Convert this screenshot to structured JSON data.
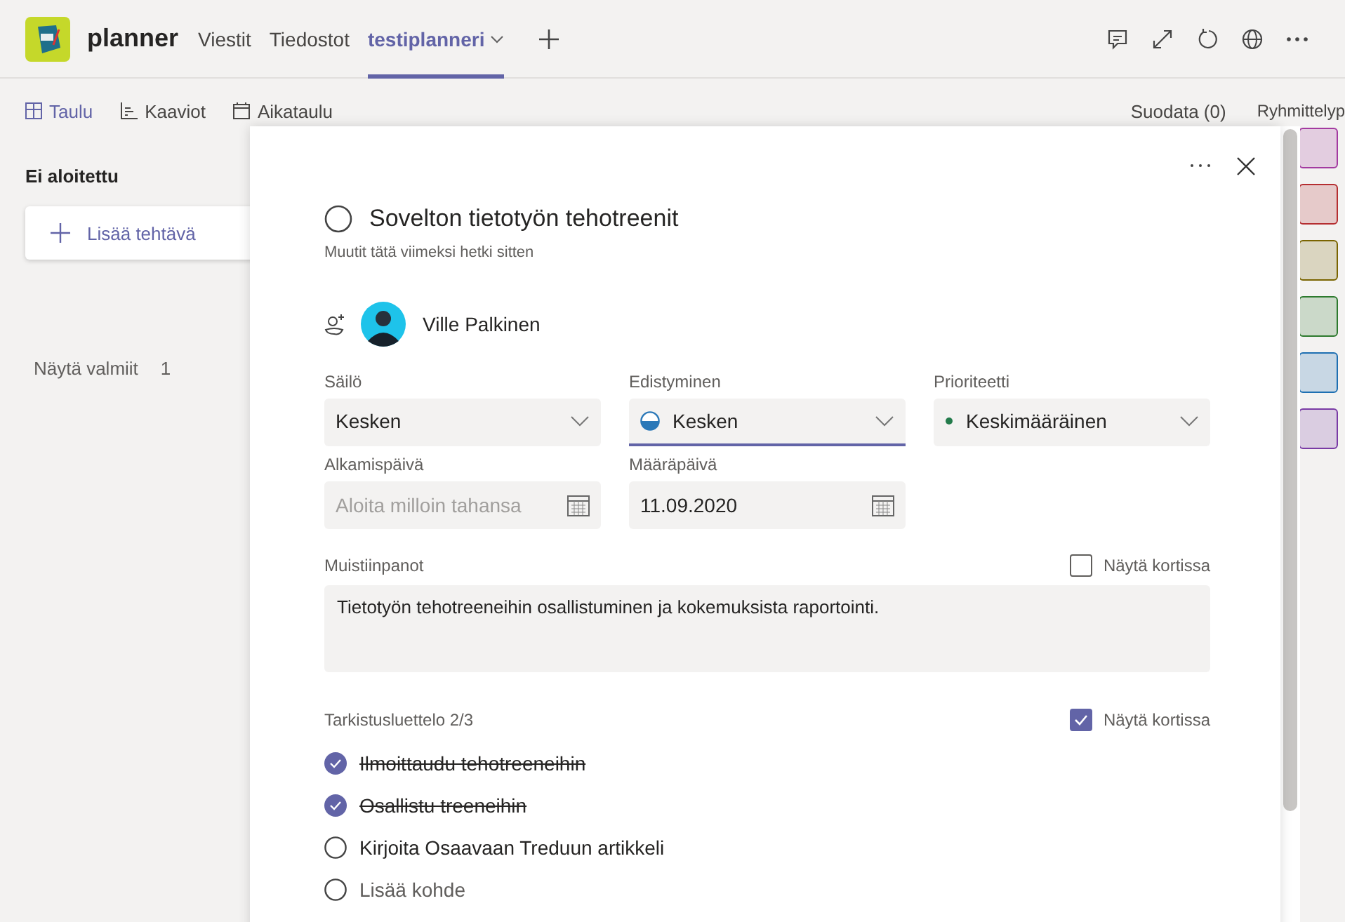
{
  "app": {
    "name": "planner",
    "tabs": [
      {
        "label": "Viestit",
        "selected": false,
        "has_menu": false
      },
      {
        "label": "Tiedostot",
        "selected": false,
        "has_menu": false
      },
      {
        "label": "testiplanneri",
        "selected": true,
        "has_menu": true
      }
    ]
  },
  "views": [
    {
      "kind": "board",
      "label": "Taulu",
      "selected": true
    },
    {
      "kind": "chart",
      "label": "Kaaviot",
      "selected": false
    },
    {
      "kind": "calendar",
      "label": "Aikataulu",
      "selected": false
    }
  ],
  "filter": "Suodata (0)",
  "group_by": "Ryhmittelyp",
  "bucket": {
    "title": "Ei aloitettu",
    "add_task": "Lisää tehtävä",
    "show_completed": "Näytä valmiit",
    "completed_count": "1"
  },
  "label_swatches": [
    {
      "color": "#a33aa0"
    },
    {
      "color": "#b52e31"
    },
    {
      "color": "#7a6400"
    },
    {
      "color": "#2d7a2e"
    },
    {
      "color": "#1e6fb2"
    },
    {
      "color": "#7a3ba5"
    }
  ],
  "task": {
    "title": "Sovelton tietotyön tehotreenit",
    "completed": false,
    "modified": "Muutit tätä viimeksi hetki sitten",
    "assignee": "Ville Palkinen",
    "fields": [
      {
        "kind": "select",
        "label": "Säilö",
        "value": "Kesken",
        "focused": false
      },
      {
        "kind": "progress",
        "label": "Edistyminen",
        "value": "Kesken",
        "focused": true
      },
      {
        "kind": "priority",
        "label": "Prioriteetti",
        "value": "Keskimääräinen",
        "focused": false
      },
      {
        "kind": "date",
        "label": "Alkamispäivä",
        "placeholder": "Aloita milloin tahansa"
      },
      {
        "kind": "date",
        "label": "Määräpäivä",
        "value": "11.09.2020"
      }
    ],
    "notes": {
      "label": "Muistiinpanot",
      "show_on_card_label": "Näytä kortissa",
      "show_on_card": false,
      "value": "Tietotyön tehotreeneihin osallistuminen ja kokemuksista raportointi."
    },
    "checklist": {
      "label": "Tarkistusluettelo 2/3",
      "show_on_card_label": "Näytä kortissa",
      "show_on_card": true,
      "items": [
        {
          "text": "Ilmoittaudu tehotreeneihin",
          "checked": true
        },
        {
          "text": "Osallistu treeneihin",
          "checked": true
        },
        {
          "text": "Kirjoita Osaavaan Treduun artikkeli",
          "checked": false
        }
      ],
      "add_placeholder": "Lisää kohde"
    }
  }
}
